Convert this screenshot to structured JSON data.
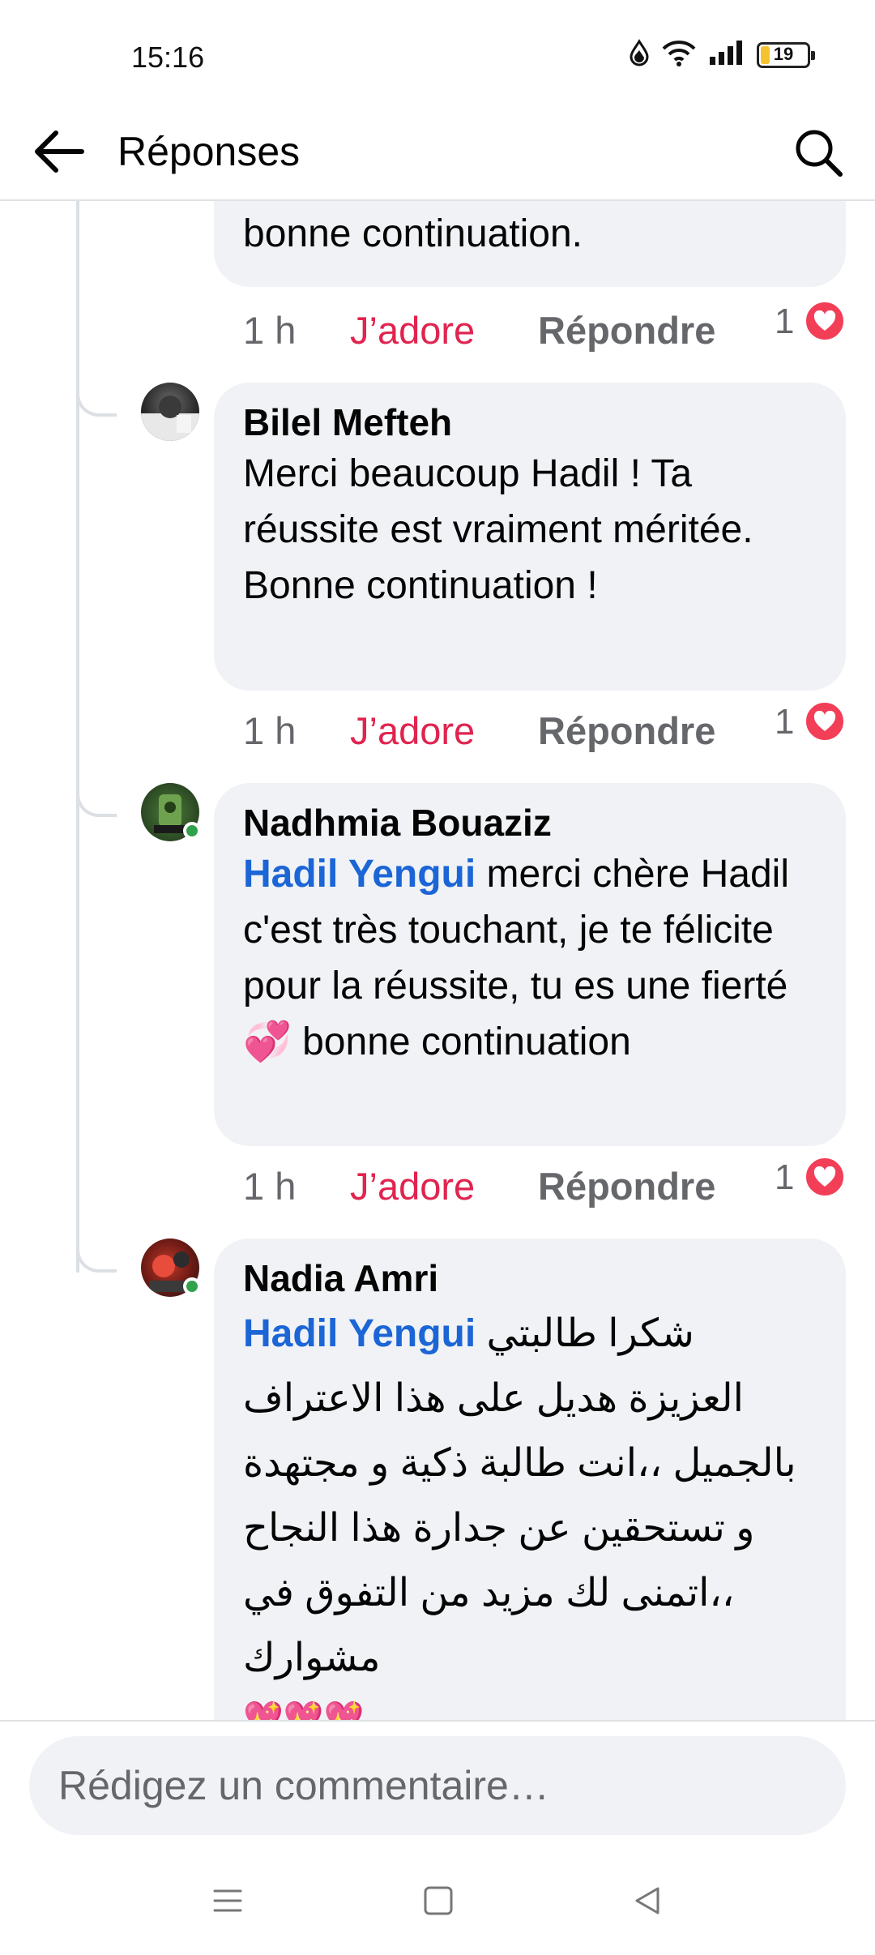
{
  "status_bar": {
    "time": "15:16",
    "battery_level": "19",
    "battery_color": "#f4c430"
  },
  "header": {
    "title": "Réponses",
    "back_icon": "arrow-left-icon",
    "search_icon": "search-icon"
  },
  "top_comment": {
    "visible_text": "bonne continuation.",
    "time": "1 h",
    "like_label": "J’adore",
    "reply_label": "Répondre",
    "reaction_count": "1"
  },
  "comments": [
    {
      "author": "Bilel Mefteh",
      "mention": "",
      "text": "Merci beaucoup Hadil ! Ta réussite est vraiment méritée. Bonne continuation !",
      "time": "1 h",
      "like_label": "J’adore",
      "reply_label": "Répondre",
      "reaction_count": "1",
      "online": false
    },
    {
      "author": "Nadhmia Bouaziz",
      "mention": "Hadil Yengui",
      "text": "merci chère Hadil c'est très touchant, je te félicite pour la réussite, tu es une fierté 💞 bonne continuation",
      "time": "1 h",
      "like_label": "J’adore",
      "reply_label": "Répondre",
      "reaction_count": "1",
      "online": true
    },
    {
      "author": "Nadia Amri",
      "mention": "Hadil Yengui",
      "text": "شكرا طالبتي العزيزة هديل على هذا الاعتراف بالجميل ،،انت طالبة ذكية و مجتهدة و تستحقين عن جدارة هذا النجاح ،،اتمنى لك مزيد من التفوق في مشوارك",
      "emoji_line": "💖💖💖",
      "online": true
    }
  ],
  "composer": {
    "placeholder": "Rédigez un commentaire…"
  },
  "nav": {
    "menu_icon": "menu-icon",
    "home_icon": "square-home-icon",
    "back_icon": "triangle-back-icon"
  },
  "colors": {
    "like": "#e0244f",
    "mention": "#1b65d6",
    "bubble": "#f0f2f5",
    "heart": "#f33e58",
    "online": "#31a24c"
  }
}
